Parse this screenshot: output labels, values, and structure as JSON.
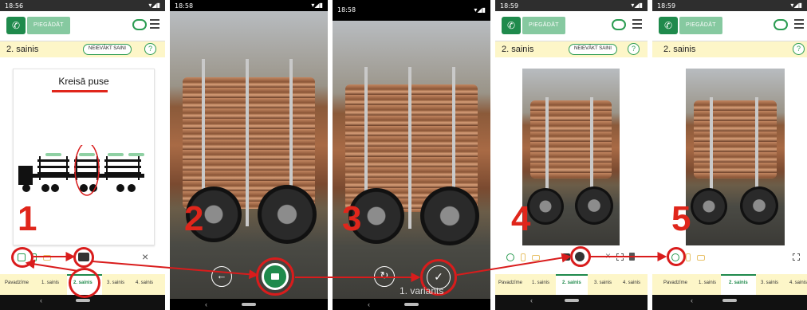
{
  "screens": [
    {
      "time": "18:56",
      "send_label": "PIEGĀDĀT",
      "section": "2. sainis",
      "nv_label": "NEIEVĀKT SAINI",
      "help": "?",
      "card_title": "Kreisā puse",
      "step": "1"
    },
    {
      "time": "18:58",
      "step": "2",
      "back_icon": "←"
    },
    {
      "time": "18:58",
      "step": "3",
      "variant_text": "1. variants",
      "retake_icon": "↻",
      "confirm_icon": "✓"
    },
    {
      "time": "18:59",
      "send_label": "PIEGĀDĀT",
      "section": "2. sainis",
      "nv_label": "NEIEVĀKT SAINI",
      "help": "?",
      "step": "4"
    },
    {
      "time": "18:59",
      "send_label": "PIEGĀDĀT",
      "section": "2. sainis",
      "help": "?",
      "step": "5"
    }
  ],
  "tabs": [
    "Pavadzīme",
    "1. sainis",
    "2. sainis",
    "3. sainis",
    "4. sainis"
  ],
  "icons": {
    "close": "×",
    "phone": "✆",
    "camera": "◘"
  },
  "colors": {
    "accent_green": "#1f8a4c",
    "highlight_red": "#e0261b",
    "section_yellow": "#fdf6c8"
  }
}
